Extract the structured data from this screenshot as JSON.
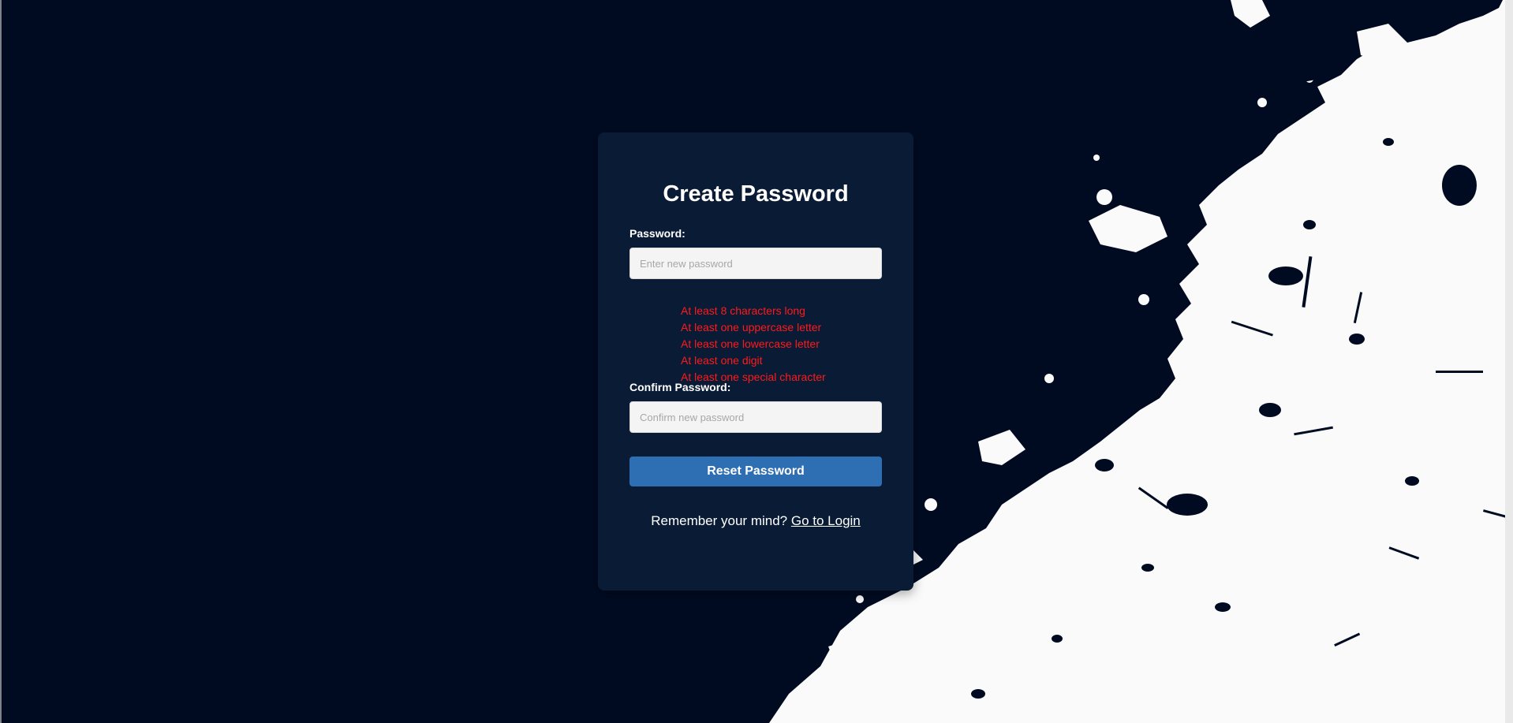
{
  "form": {
    "title": "Create Password",
    "password_label": "Password:",
    "password_placeholder": "Enter new password",
    "requirements": [
      "At least 8 characters long",
      "At least one uppercase letter",
      "At least one lowercase letter",
      "At least one digit",
      "At least one special character"
    ],
    "confirm_label": "Confirm Password:",
    "confirm_placeholder": "Confirm new password",
    "submit_label": "Reset Password",
    "footer_text": "Remember your mind?",
    "login_link": "Go to Login"
  },
  "colors": {
    "background": "#000b22",
    "card": "#0a1b35",
    "accent": "#2e6eb3",
    "error": "#ff1a1a",
    "splash": "#fafafa"
  }
}
